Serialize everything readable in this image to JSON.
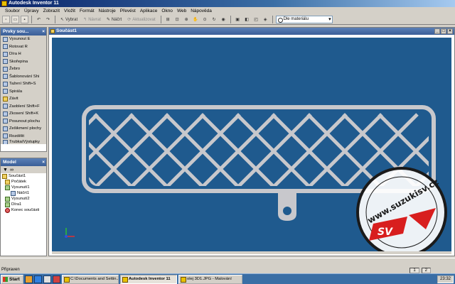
{
  "window": {
    "title": "Autodesk Inventor 11"
  },
  "menu": [
    "Soubor",
    "Úpravy",
    "Zobrazit",
    "Vložit",
    "Formát",
    "Nástroje",
    "Převést",
    "Aplikace",
    "Okno",
    "Web",
    "Nápověda"
  ],
  "toolbar": {
    "select_label": "Vybrat",
    "return_label": "Návrat",
    "sketch_label": "Náčrt",
    "update_label": "Aktualizovat",
    "material_value": "Dle materiálu"
  },
  "features_panel": {
    "title": "Prvky sou...",
    "items": [
      {
        "label": "Vysunout   E",
        "icon": "extrude-icon"
      },
      {
        "label": "Rotovat   R",
        "icon": "revolve-icon"
      },
      {
        "label": "Díra   H",
        "icon": "hole-icon"
      },
      {
        "label": "Skořepina",
        "icon": "shell-icon"
      },
      {
        "label": "Žebro",
        "icon": "rib-icon"
      },
      {
        "label": "Šablonování   Shi",
        "icon": "loft-icon"
      },
      {
        "label": "Tažení   Shift+S",
        "icon": "sweep-icon"
      },
      {
        "label": "Spirála",
        "icon": "coil-icon"
      },
      {
        "label": "Závit",
        "icon": "thread-icon"
      },
      {
        "label": "Zaoblení   Shift+F",
        "icon": "fillet-icon"
      },
      {
        "label": "Zkosení   Shift+K",
        "icon": "chamfer-icon"
      },
      {
        "label": "Posunout plochu",
        "icon": "move-face-icon"
      },
      {
        "label": "Zešikmení plochy",
        "icon": "face-draft-icon"
      },
      {
        "label": "Rozdělit",
        "icon": "split-icon"
      },
      {
        "label": "Trubka/Výstupky",
        "icon": "boss-icon"
      }
    ]
  },
  "model_panel": {
    "title": "Model",
    "tree": [
      {
        "label": "Součást1",
        "level": 0,
        "icon": "part-icon"
      },
      {
        "label": "Počátek",
        "level": 1,
        "icon": "folder-icon"
      },
      {
        "label": "Vysunutí1",
        "level": 1,
        "icon": "extrusion-icon"
      },
      {
        "label": "Náčrt1",
        "level": 2,
        "icon": "sketch-icon"
      },
      {
        "label": "Vysunutí2",
        "level": 1,
        "icon": "extrusion-icon"
      },
      {
        "label": "Díra1",
        "level": 1,
        "icon": "hole-icon"
      },
      {
        "label": "Konec součásti",
        "level": 1,
        "icon": "end-of-part-icon"
      }
    ]
  },
  "document": {
    "tab_title": "Součást1"
  },
  "status": {
    "text": "Připraven",
    "num1": "1",
    "num2": "2"
  },
  "taskbar": {
    "start_label": "Start",
    "tasks": [
      {
        "label": "C:\\Documents and Settin...",
        "active": false
      },
      {
        "label": "Autodesk Inventor 11",
        "active": true
      },
      {
        "label": "olej 3D1.JPG - Malování",
        "active": false
      }
    ],
    "clock": "23:32"
  },
  "watermark": {
    "text": "www.suzukisv.cz",
    "logo": "SV"
  },
  "colors": {
    "viewport_bg": "#1f5a8e",
    "part": "#c8c8cc",
    "title_bar": "#0a246a",
    "taskbar": "#3a6ea5"
  }
}
